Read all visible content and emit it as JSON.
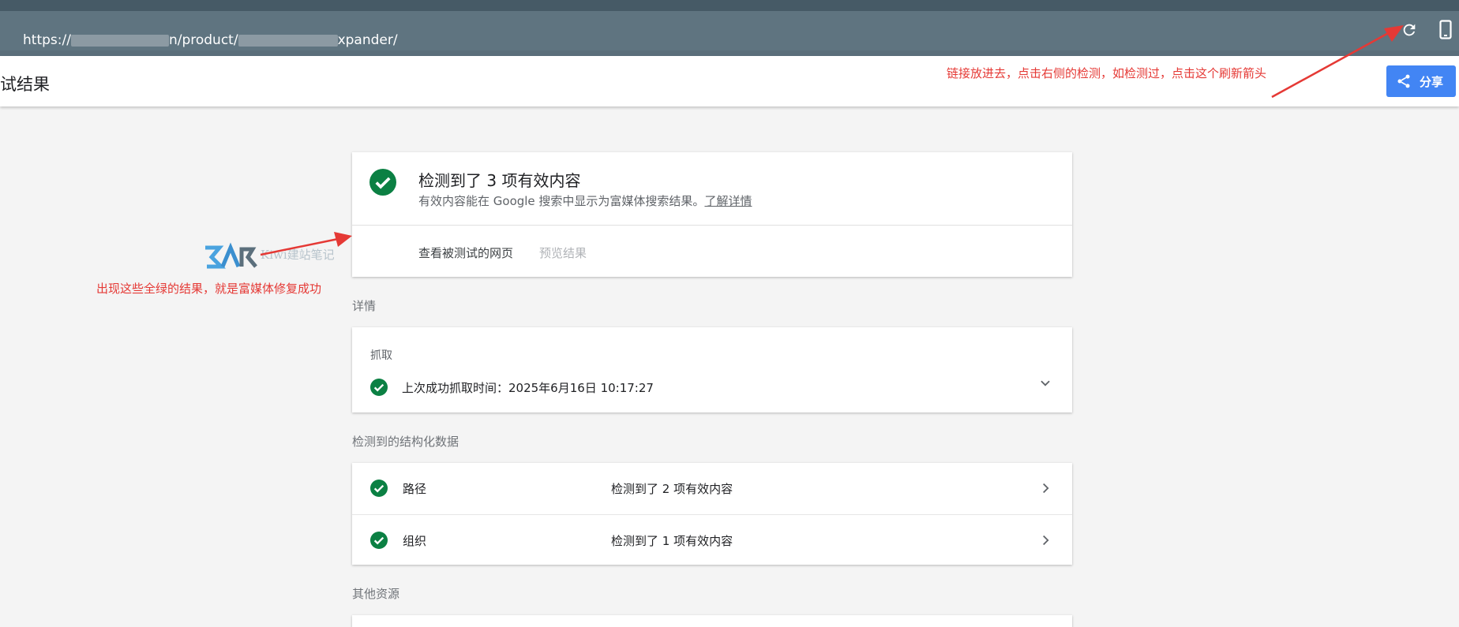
{
  "browser": {
    "url_prefix": "https://",
    "url_mid1": "n/product/",
    "url_end": "xpander/",
    "refresh_icon": "refresh-icon",
    "device_icon": "smartphone-icon"
  },
  "header": {
    "title": "试结果",
    "share_label": "分享",
    "share_icon": "share-icon"
  },
  "annotations": {
    "top": "链接放进去，点击右侧的检测，如检测过，点击这个刷新箭头",
    "left": "出现这些全绿的结果，就是富媒体修复成功",
    "color": "#e53935"
  },
  "watermark": {
    "text": "Kiwi建站笔记"
  },
  "summary": {
    "title": "检测到了 3 项有效内容",
    "subtitle": "有效内容能在 Google 搜索中显示为富媒体搜索结果。",
    "learn_more": "了解详情",
    "tab_tested_page": "查看被测试的网页",
    "tab_preview": "预览结果"
  },
  "details": {
    "section_label": "详情",
    "fetch_label": "抓取",
    "fetch_status": "上次成功抓取时间：2025年6月16日 10:17:27"
  },
  "structured_data": {
    "section_label": "检测到的结构化数据",
    "items": [
      {
        "name": "路径",
        "status": "检测到了 2 项有效内容"
      },
      {
        "name": "组织",
        "status": "检测到了 1 项有效内容"
      }
    ]
  },
  "other": {
    "section_label": "其他资源"
  },
  "colors": {
    "success_green": "#0b8043",
    "accent_blue": "#4285f4",
    "toolbar": "#5f7480"
  }
}
